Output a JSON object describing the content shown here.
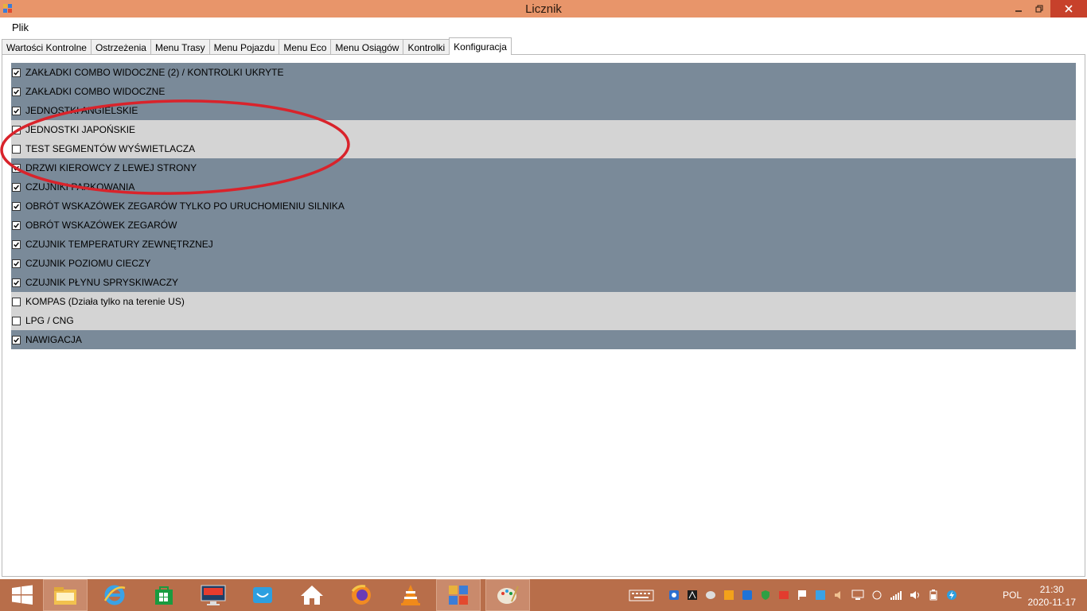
{
  "window": {
    "title": "Licznik"
  },
  "menubar": {
    "file_label": "Plik"
  },
  "tabs": [
    {
      "label": "Wartości Kontrolne",
      "active": false
    },
    {
      "label": "Ostrzeżenia",
      "active": false
    },
    {
      "label": "Menu Trasy",
      "active": false
    },
    {
      "label": "Menu Pojazdu",
      "active": false
    },
    {
      "label": "Menu Eco",
      "active": false
    },
    {
      "label": "Menu Osiągów",
      "active": false
    },
    {
      "label": "Kontrolki",
      "active": false
    },
    {
      "label": "Konfiguracja",
      "active": true
    }
  ],
  "config_items": [
    {
      "label": "ZAKŁADKI COMBO WIDOCZNE (2) / KONTROLKI UKRYTE",
      "checked": true
    },
    {
      "label": "ZAKŁADKI COMBO WIDOCZNE",
      "checked": true
    },
    {
      "label": "JEDNOSTKI ANGIELSKIE",
      "checked": true
    },
    {
      "label": "JEDNOSTKI JAPOŃSKIE",
      "checked": false
    },
    {
      "label": "TEST SEGMENTÓW WYŚWIETLACZA",
      "checked": false
    },
    {
      "label": "DRZWI KIEROWCY Z LEWEJ STRONY",
      "checked": true
    },
    {
      "label": "CZUJNIKI PARKOWANIA",
      "checked": true
    },
    {
      "label": "OBRÓT WSKAZÓWEK ZEGARÓW TYLKO PO URUCHOMIENIU SILNIKA",
      "checked": true
    },
    {
      "label": "OBRÓT WSKAZÓWEK ZEGARÓW",
      "checked": true
    },
    {
      "label": "CZUJNIK TEMPERATURY ZEWNĘTRZNEJ",
      "checked": true
    },
    {
      "label": "CZUJNIK POZIOMU CIECZY",
      "checked": true
    },
    {
      "label": "CZUJNIK PŁYNU SPRYSKIWACZY",
      "checked": true
    },
    {
      "label": "KOMPAS (Działa tylko na terenie US)",
      "checked": false
    },
    {
      "label": "LPG / CNG",
      "checked": false
    },
    {
      "label": "NAWIGACJA",
      "checked": true
    }
  ],
  "annotation": {
    "color": "#d9232b",
    "shape": "ellipse"
  },
  "taskbar": {
    "pinned": [
      "start-icon",
      "file-explorer-icon",
      "internet-explorer-icon",
      "store-icon",
      "lenovo-icon",
      "mail-icon",
      "home-icon",
      "firefox-icon",
      "vlc-icon",
      "licznik-app-icon",
      "paint-icon"
    ],
    "language": "POL",
    "time": "21:30",
    "date": "2020-11-17"
  },
  "colors": {
    "titlebar": "#e8956a",
    "taskbar": "#b86e4a",
    "row_checked": "#7a8a99",
    "row_unchecked": "#d4d4d4",
    "close_button": "#c7412b"
  }
}
